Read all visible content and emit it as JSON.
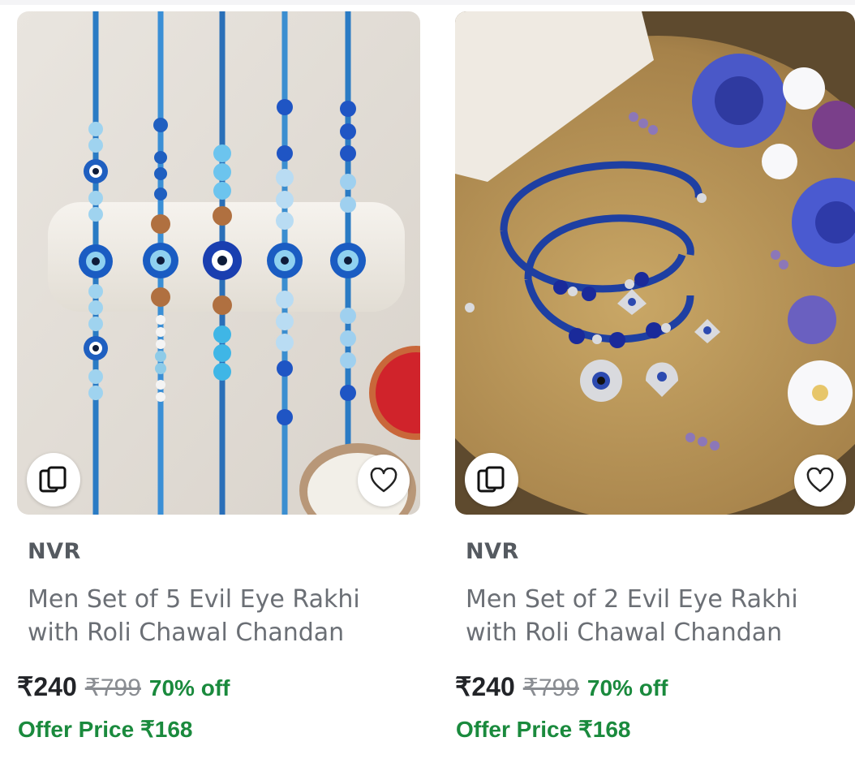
{
  "products": [
    {
      "brand": "NVR",
      "title": "Men Set of 5 Evil Eye Rakhi with Roli Chawal Chandan",
      "price": "₹240",
      "mrp": "₹799",
      "discount": "70% off",
      "offer_price": "Offer Price ₹168",
      "image": "evil-eye-rakhi-set-of-5-photo"
    },
    {
      "brand": "NVR",
      "title": "Men Set of 2 Evil Eye Rakhi with Roli Chawal Chandan",
      "price": "₹240",
      "mrp": "₹799",
      "discount": "70% off",
      "offer_price": "Offer Price ₹168",
      "image": "evil-eye-rakhi-set-of-2-photo"
    }
  ],
  "icons": {
    "similar": "view-similar-icon",
    "wishlist": "heart-icon"
  },
  "colors": {
    "discount_green": "#1a8a3d",
    "brand_gray": "#555a60",
    "title_gray": "#6b6f75"
  }
}
